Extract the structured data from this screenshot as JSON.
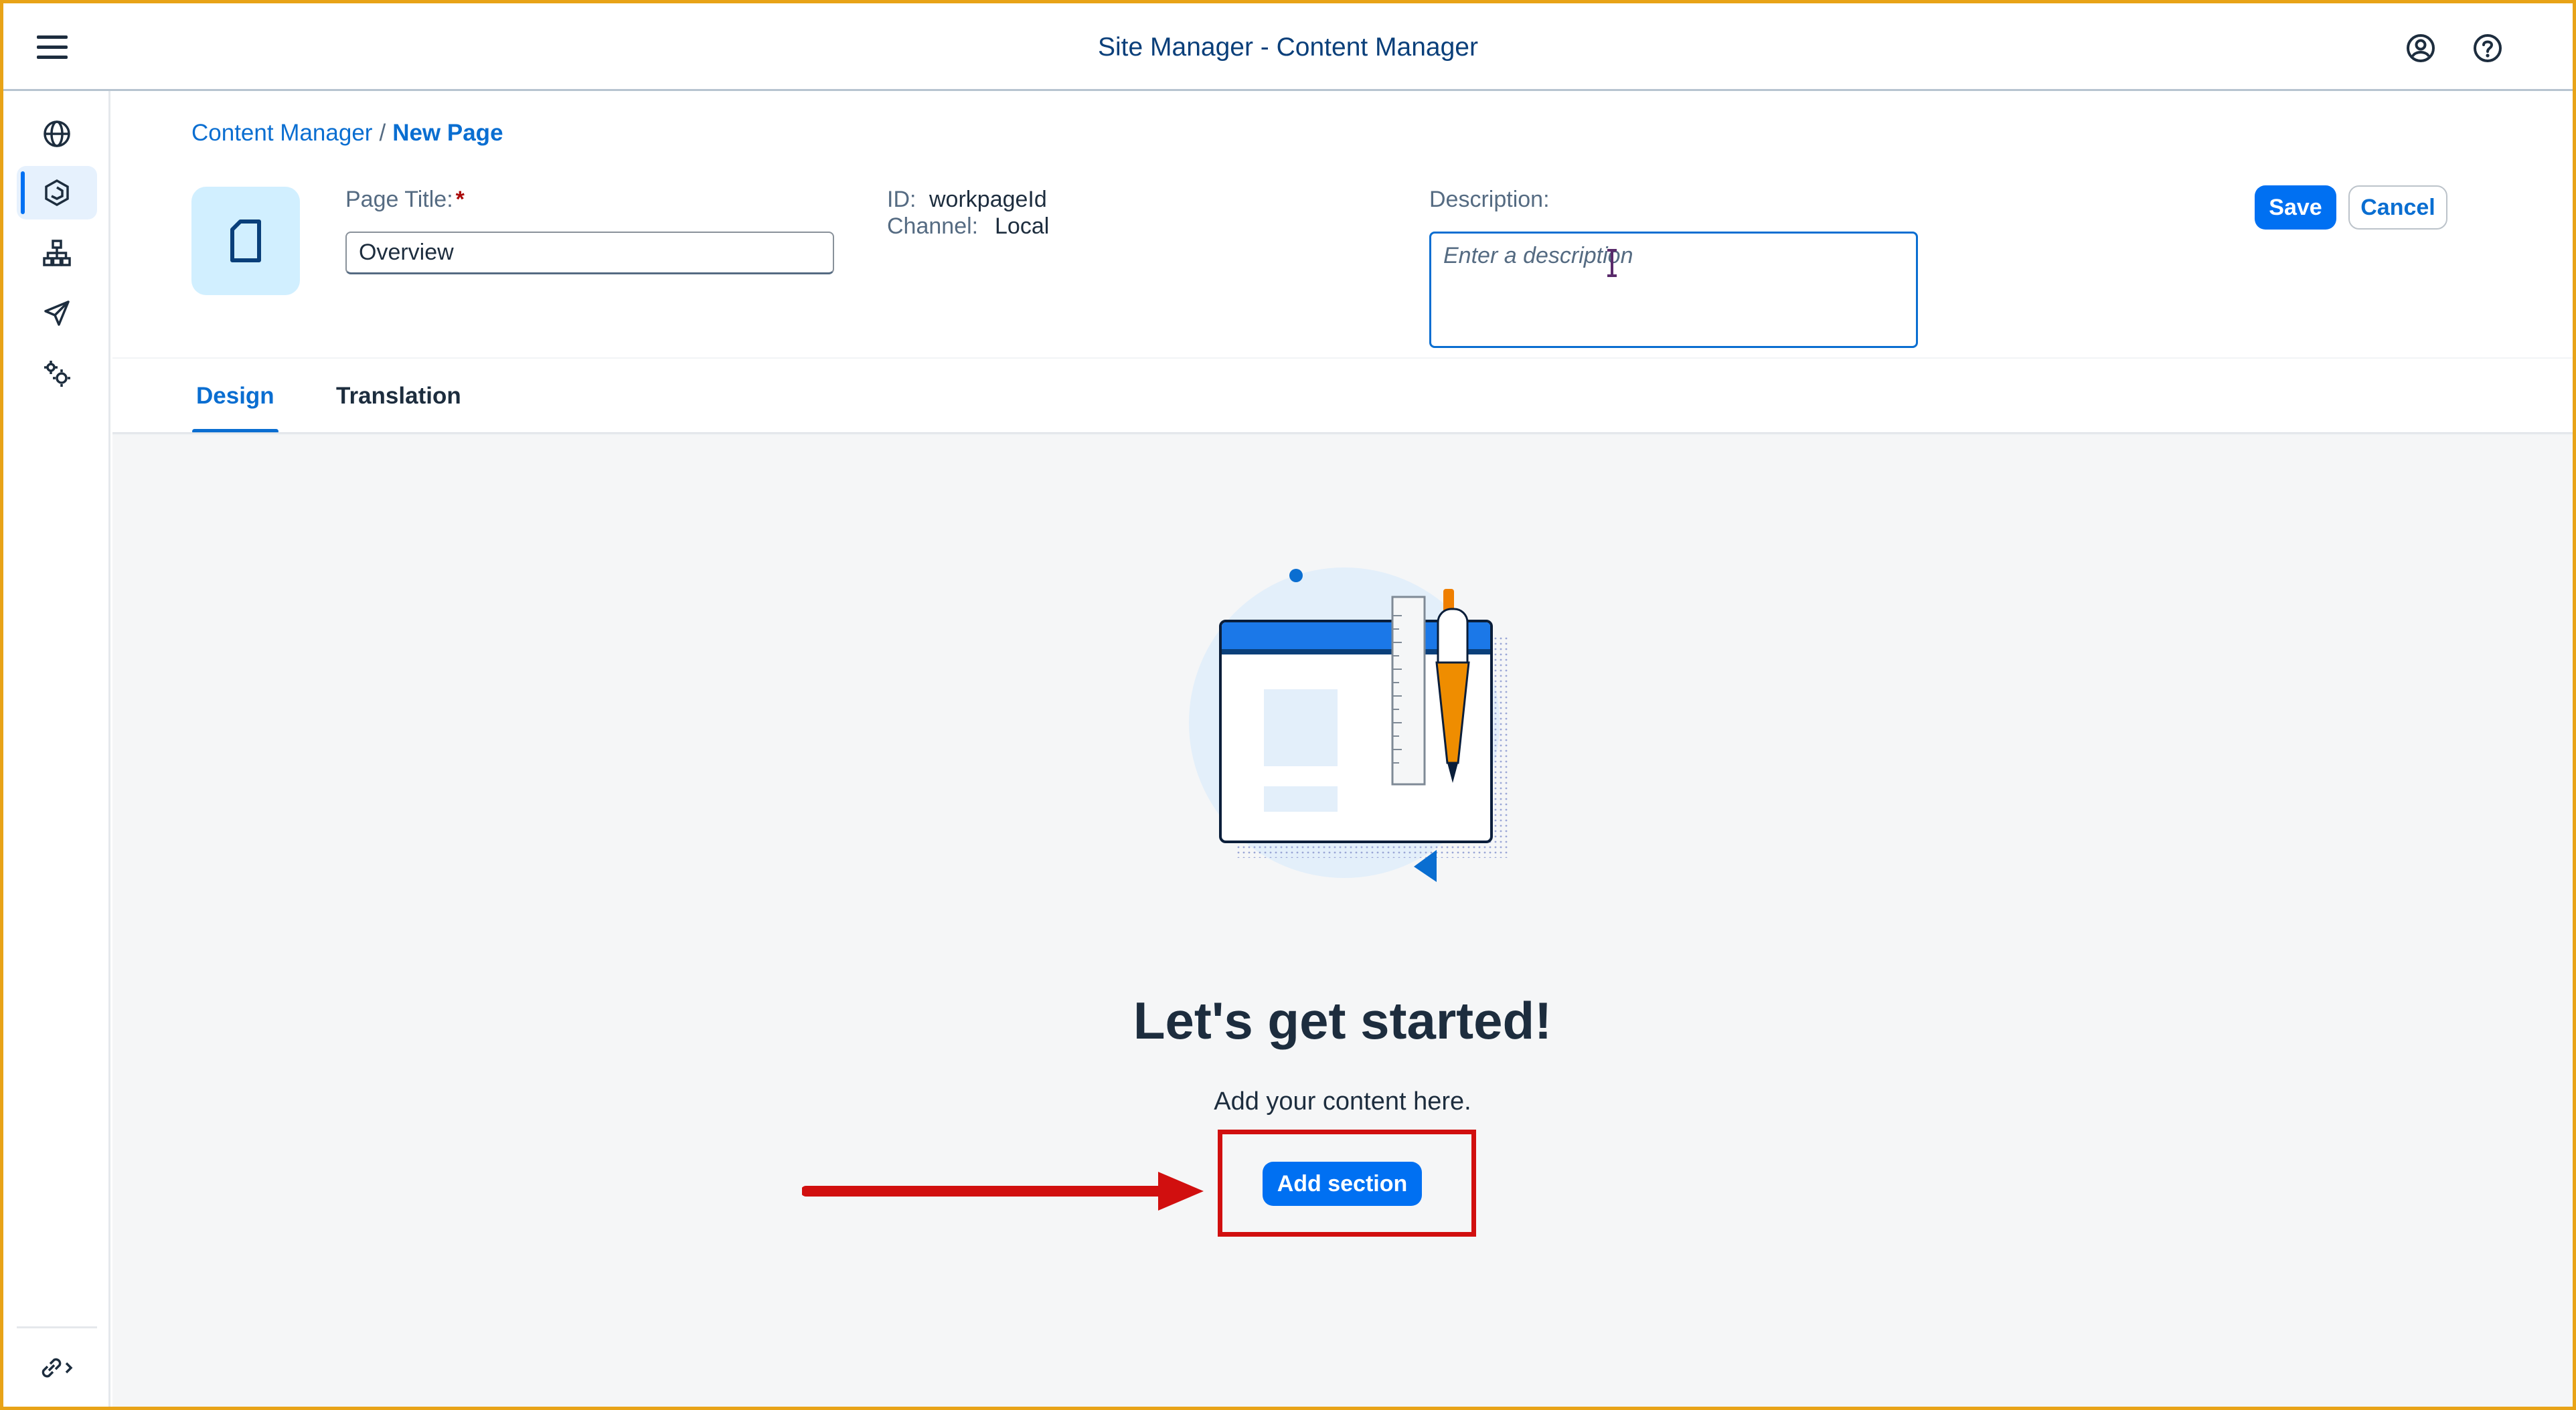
{
  "shell": {
    "title": "Site Manager - Content Manager",
    "icons": [
      "menu-icon",
      "user-icon",
      "help-icon"
    ]
  },
  "sidenav": {
    "items": [
      {
        "name": "globe-icon",
        "active": false
      },
      {
        "name": "content-manager-icon",
        "active": true
      },
      {
        "name": "hierarchy-icon",
        "active": false
      },
      {
        "name": "send-icon",
        "active": false
      },
      {
        "name": "settings-icon",
        "active": false
      }
    ],
    "footer_icon": "link-expand-icon"
  },
  "breadcrumb": {
    "parent": "Content Manager",
    "separator": "/",
    "current": "New Page"
  },
  "page": {
    "title_label": "Page Title:",
    "required_mark": "*",
    "title_value": "Overview",
    "id_label": "ID:",
    "id_value": "workpageId",
    "channel_label": "Channel:",
    "channel_value": "Local",
    "description_label": "Description:",
    "description_placeholder": "Enter a description"
  },
  "actions": {
    "save": "Save",
    "cancel": "Cancel"
  },
  "tabs": [
    {
      "label": "Design",
      "active": true
    },
    {
      "label": "Translation",
      "active": false
    }
  ],
  "empty_state": {
    "heading": "Let's get started!",
    "subtext": "Add your content here.",
    "button": "Add section"
  },
  "colors": {
    "brand": "#0070f2",
    "link": "#0a6ed1",
    "annotation": "#d10f0f",
    "frame": "#e8a317"
  }
}
